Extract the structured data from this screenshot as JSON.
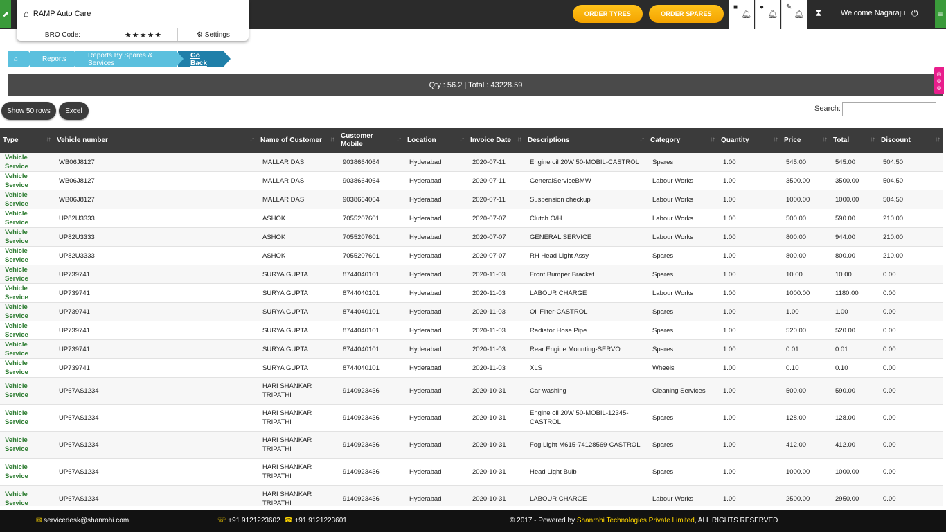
{
  "header": {
    "brand": "RAMP Auto Care",
    "bro_code_label": "BRO Code:",
    "stars": "★★★★★",
    "settings_label": "Settings",
    "order_tyres": "ORDER TYRES",
    "order_spares": "ORDER SPARES",
    "welcome": "Welcome  Nagaraju"
  },
  "breadcrumb": {
    "items": [
      "Reports",
      "Reports By Spares & Services"
    ],
    "go_back": "Go Back"
  },
  "summary": "Qty : 56.2 | Total : 43228.59",
  "toolbar": {
    "show_rows": "Show 50 rows",
    "excel": "Excel",
    "search_label": "Search:",
    "search_value": ""
  },
  "table": {
    "columns": [
      "Type",
      "Vehicle number",
      "Name of Customer",
      "Customer Mobile",
      "Location",
      "Invoice Date",
      "Descriptions",
      "Category",
      "Quantity",
      "Price",
      "Total",
      "Discount"
    ],
    "rows": [
      [
        "Vehicle Service",
        "WB06J8127",
        "MALLAR DAS",
        "9038664064",
        "Hyderabad",
        "2020-07-11",
        "Engine oil 20W 50-MOBIL-CASTROL",
        "Spares",
        "1.00",
        "545.00",
        "545.00",
        "504.50"
      ],
      [
        "Vehicle Service",
        "WB06J8127",
        "MALLAR DAS",
        "9038664064",
        "Hyderabad",
        "2020-07-11",
        "GeneralServiceBMW",
        "Labour Works",
        "1.00",
        "3500.00",
        "3500.00",
        "504.50"
      ],
      [
        "Vehicle Service",
        "WB06J8127",
        "MALLAR DAS",
        "9038664064",
        "Hyderabad",
        "2020-07-11",
        "Suspension checkup",
        "Labour Works",
        "1.00",
        "1000.00",
        "1000.00",
        "504.50"
      ],
      [
        "Vehicle Service",
        "UP82U3333",
        "ASHOK",
        "7055207601",
        "Hyderabad",
        "2020-07-07",
        "Clutch O/H",
        "Labour Works",
        "1.00",
        "500.00",
        "590.00",
        "210.00"
      ],
      [
        "Vehicle Service",
        "UP82U3333",
        "ASHOK",
        "7055207601",
        "Hyderabad",
        "2020-07-07",
        "GENERAL SERVICE",
        "Labour Works",
        "1.00",
        "800.00",
        "944.00",
        "210.00"
      ],
      [
        "Vehicle Service",
        "UP82U3333",
        "ASHOK",
        "7055207601",
        "Hyderabad",
        "2020-07-07",
        "RH Head Light Assy",
        "Spares",
        "1.00",
        "800.00",
        "800.00",
        "210.00"
      ],
      [
        "Vehicle Service",
        "UP739741",
        "SURYA GUPTA",
        "8744040101",
        "Hyderabad",
        "2020-11-03",
        "Front Bumper Bracket",
        "Spares",
        "1.00",
        "10.00",
        "10.00",
        "0.00"
      ],
      [
        "Vehicle Service",
        "UP739741",
        "SURYA GUPTA",
        "8744040101",
        "Hyderabad",
        "2020-11-03",
        "LABOUR CHARGE",
        "Labour Works",
        "1.00",
        "1000.00",
        "1180.00",
        "0.00"
      ],
      [
        "Vehicle Service",
        "UP739741",
        "SURYA GUPTA",
        "8744040101",
        "Hyderabad",
        "2020-11-03",
        "Oil Filter-CASTROL",
        "Spares",
        "1.00",
        "1.00",
        "1.00",
        "0.00"
      ],
      [
        "Vehicle Service",
        "UP739741",
        "SURYA GUPTA",
        "8744040101",
        "Hyderabad",
        "2020-11-03",
        "Radiator Hose Pipe",
        "Spares",
        "1.00",
        "520.00",
        "520.00",
        "0.00"
      ],
      [
        "Vehicle Service",
        "UP739741",
        "SURYA GUPTA",
        "8744040101",
        "Hyderabad",
        "2020-11-03",
        "Rear Engine Mounting-SERVO",
        "Spares",
        "1.00",
        "0.01",
        "0.01",
        "0.00"
      ],
      [
        "Vehicle Service",
        "UP739741",
        "SURYA GUPTA",
        "8744040101",
        "Hyderabad",
        "2020-11-03",
        "XLS",
        "Wheels",
        "1.00",
        "0.10",
        "0.10",
        "0.00"
      ],
      [
        "Vehicle Service",
        "UP67AS1234",
        "HARI SHANKAR TRIPATHI",
        "9140923436",
        "Hyderabad",
        "2020-10-31",
        "Car washing",
        "Cleaning Services",
        "1.00",
        "500.00",
        "590.00",
        "0.00"
      ],
      [
        "Vehicle Service",
        "UP67AS1234",
        "HARI SHANKAR TRIPATHI",
        "9140923436",
        "Hyderabad",
        "2020-10-31",
        "Engine oil 20W 50-MOBIL-12345-CASTROL",
        "Spares",
        "1.00",
        "128.00",
        "128.00",
        "0.00"
      ],
      [
        "Vehicle Service",
        "UP67AS1234",
        "HARI SHANKAR TRIPATHI",
        "9140923436",
        "Hyderabad",
        "2020-10-31",
        "Fog Light M615-74128569-CASTROL",
        "Spares",
        "1.00",
        "412.00",
        "412.00",
        "0.00"
      ],
      [
        "Vehicle Service",
        "UP67AS1234",
        "HARI SHANKAR TRIPATHI",
        "9140923436",
        "Hyderabad",
        "2020-10-31",
        "Head Light Bulb",
        "Spares",
        "1.00",
        "1000.00",
        "1000.00",
        "0.00"
      ],
      [
        "Vehicle Service",
        "UP67AS1234",
        "HARI SHANKAR TRIPATHI",
        "9140923436",
        "Hyderabad",
        "2020-10-31",
        "LABOUR CHARGE",
        "Labour Works",
        "1.00",
        "2500.00",
        "2950.00",
        "0.00"
      ]
    ]
  },
  "footer": {
    "email": "servicedesk@shanrohi.com",
    "phone1": "+91 9121223602",
    "phone2": "+91 9121223601",
    "copyright_prefix": "© 2017 - Powered by ",
    "company": "Shanrohi Technologies Private Limited",
    "rights": ", ALL RIGHTS RESERVED"
  },
  "colors": {
    "accent_orange": "#f4a300",
    "breadcrumb_blue": "#5bc0de",
    "type_green": "#2e7d32",
    "side_widget_pink": "#e91e8c"
  }
}
